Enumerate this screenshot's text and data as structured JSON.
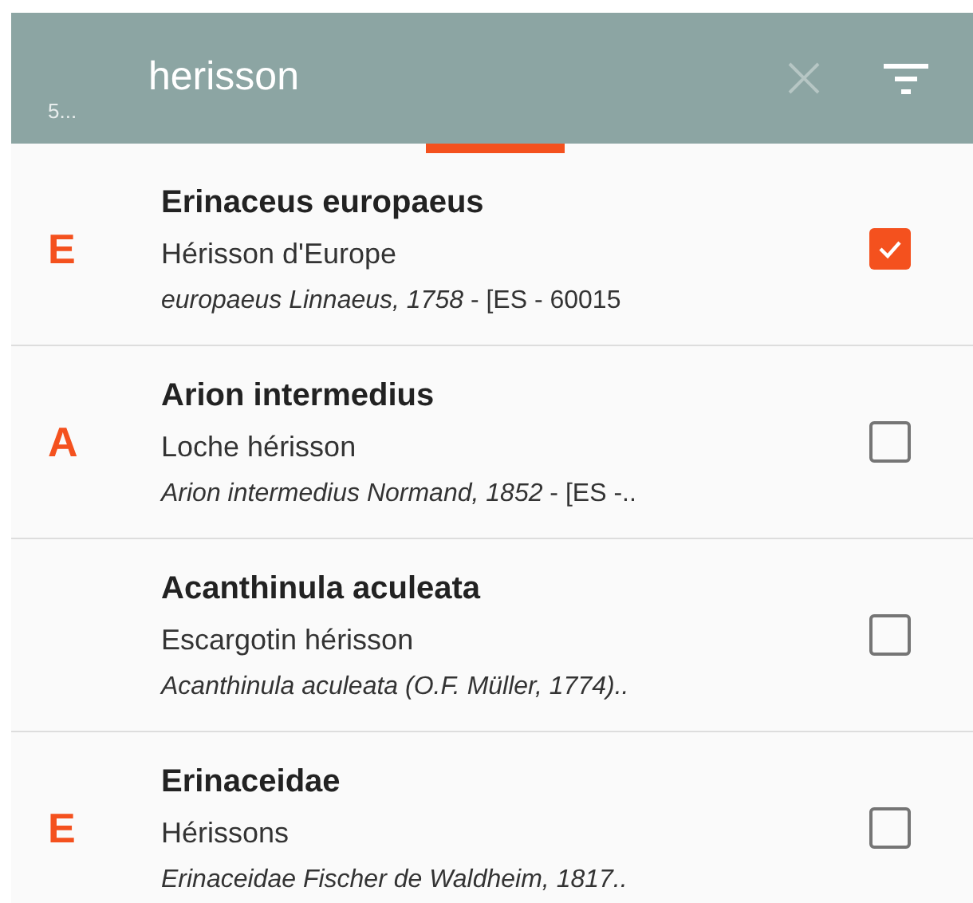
{
  "header": {
    "count": "5...",
    "search": {
      "value": "herisson"
    }
  },
  "results": [
    {
      "letter": "E",
      "title": "Erinaceus europaeus",
      "common_name": "Hérisson d'Europe",
      "reference": "*europaeus Linnaeus, 1758* - [ES - 60015",
      "checked": true
    },
    {
      "letter": "A",
      "title": "Arion intermedius",
      "common_name": "Loche hérisson",
      "reference": "*Arion intermedius Normand, 1852* - [ES -..",
      "checked": false
    },
    {
      "title": "Acanthinula aculeata",
      "common_name": "Escargotin hérisson",
      "reference": "*Acanthinula aculeata (O.F. Müller, 1774)..*",
      "checked": false
    },
    {
      "letter": "E",
      "title": "Erinaceidae",
      "common_name": "Hérissons",
      "reference": "*Erinaceidae Fischer de Waldheim, 1817..*",
      "checked": false
    }
  ]
}
